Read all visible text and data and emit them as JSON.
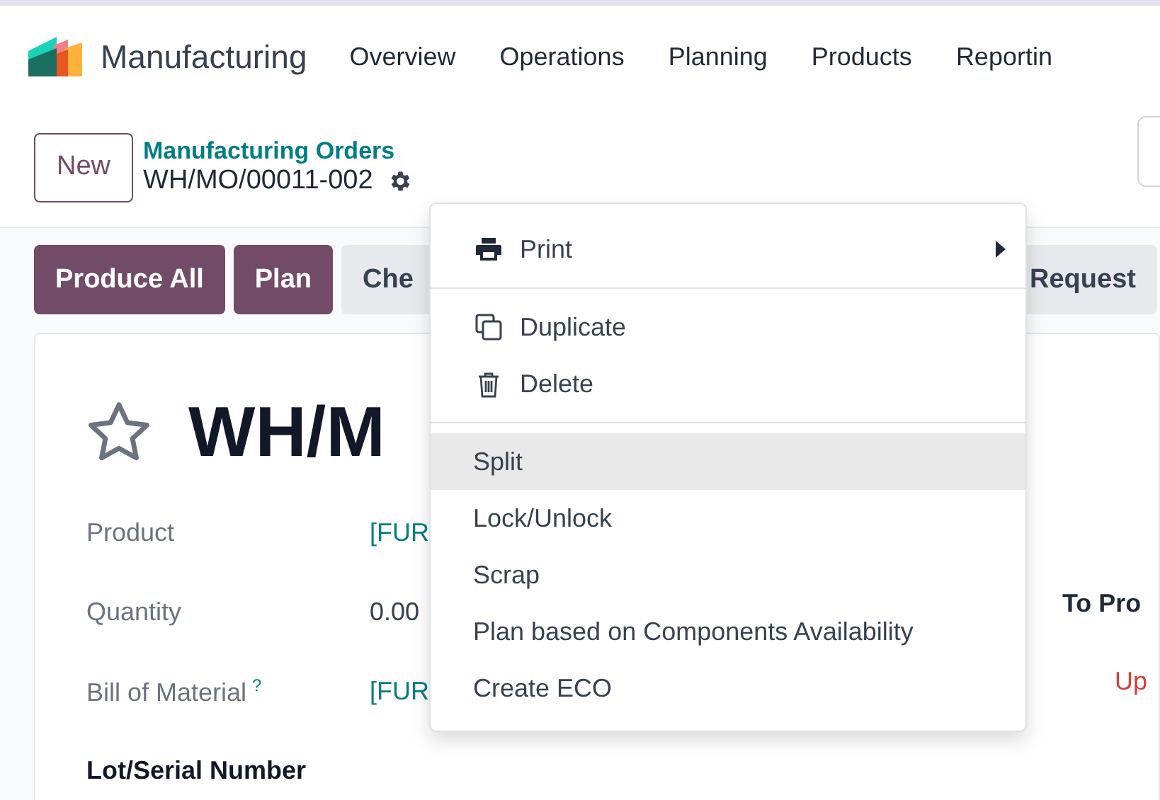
{
  "navbar": {
    "app_name": "Manufacturing",
    "menu": [
      "Overview",
      "Operations",
      "Planning",
      "Products",
      "Reportin"
    ]
  },
  "control_panel": {
    "new_button": "New",
    "breadcrumb": "Manufacturing Orders",
    "record_name": "WH/MO/00011-002"
  },
  "action_buttons": [
    {
      "label": "Produce All",
      "kind": "primary"
    },
    {
      "label": "Plan",
      "kind": "primary"
    },
    {
      "label": "Che",
      "kind": "secondary"
    },
    {
      "label": "Request",
      "kind": "secondary"
    }
  ],
  "form": {
    "favorite": false,
    "title": "WH/M",
    "fields": [
      {
        "label": "Product",
        "value": "[FUR",
        "kind": "link"
      },
      {
        "label": "Quantity",
        "value": "0.00",
        "kind": "plain"
      },
      {
        "label": "Bill of Material",
        "help": "?",
        "value": "[FUR",
        "kind": "link"
      },
      {
        "label": "Lot/Serial Number",
        "kind": "heading"
      }
    ],
    "side_label": "To Pro",
    "side_warning": "Up"
  },
  "gear_menu": {
    "sections": [
      [
        {
          "label": "Print",
          "kind": "print",
          "submenu": true,
          "selected": false
        }
      ],
      [
        {
          "label": "Duplicate",
          "kind": "duplicate",
          "submenu": false,
          "selected": false
        },
        {
          "label": "Delete",
          "kind": "delete",
          "submenu": false,
          "selected": false
        }
      ],
      [
        {
          "label": "Split",
          "kind": "plain",
          "submenu": false,
          "selected": true
        },
        {
          "label": "Lock/Unlock",
          "kind": "plain",
          "submenu": false,
          "selected": false
        },
        {
          "label": "Scrap",
          "kind": "plain",
          "submenu": false,
          "selected": false
        },
        {
          "label": "Plan based on Components Availability",
          "kind": "plain",
          "submenu": false,
          "selected": false
        },
        {
          "label": "Create ECO",
          "kind": "plain",
          "submenu": false,
          "selected": false
        }
      ]
    ]
  }
}
